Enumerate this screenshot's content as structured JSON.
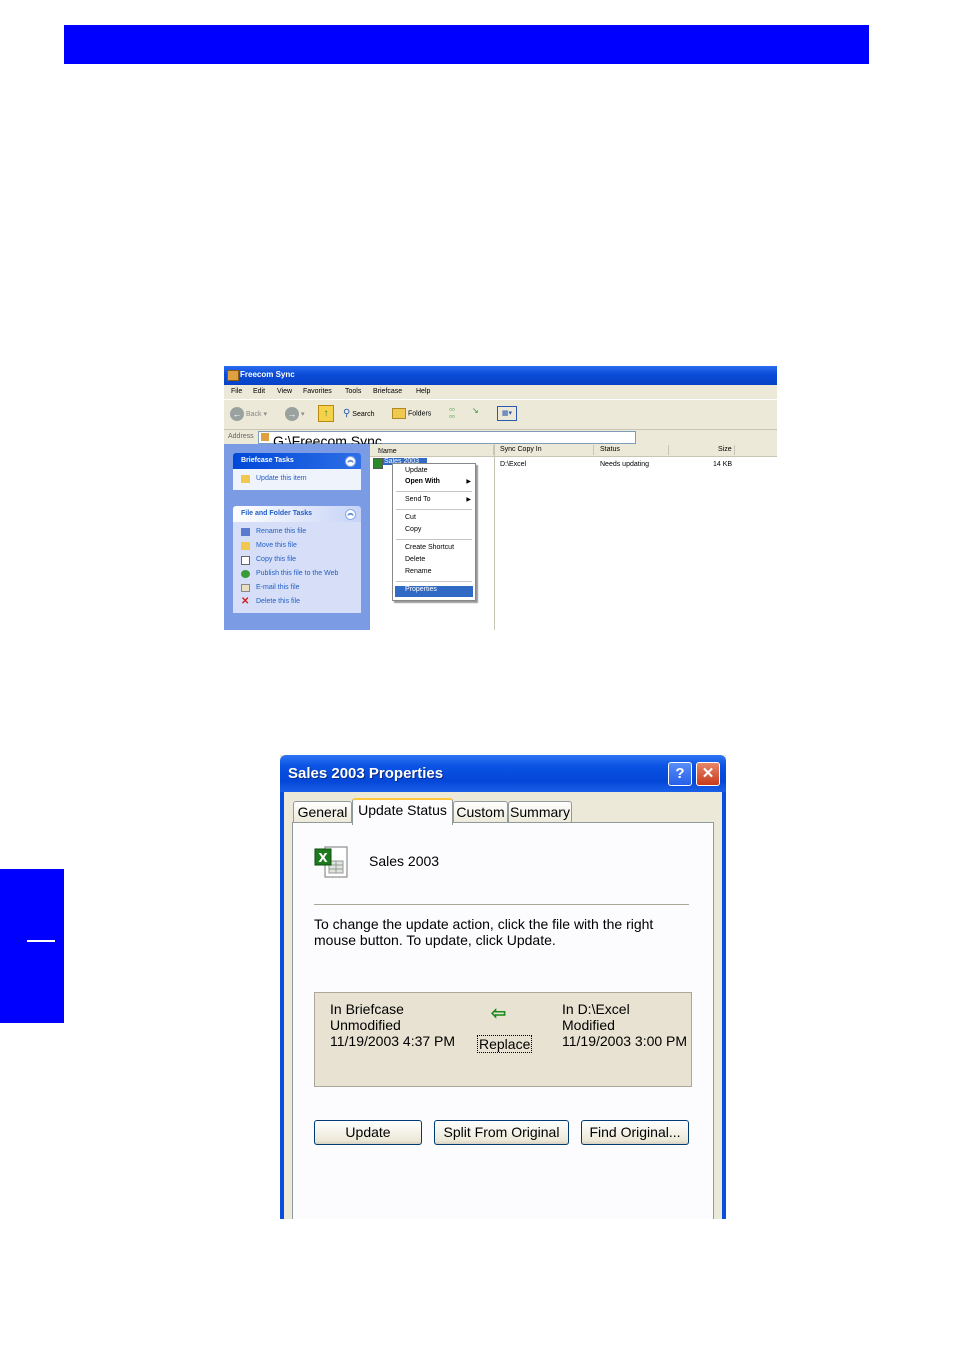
{
  "explorer": {
    "title": "Freecom Sync",
    "menu": [
      "File",
      "Edit",
      "View",
      "Favorites",
      "Tools",
      "Briefcase",
      "Help"
    ],
    "toolbar": {
      "back": "Back",
      "search": "Search",
      "folders": "Folders"
    },
    "address_label": "Address",
    "address_value": "G:\\Freecom Sync",
    "briefcase_tasks": {
      "title": "Briefcase Tasks",
      "items": [
        "Update this item"
      ]
    },
    "file_folder_tasks": {
      "title": "File and Folder Tasks",
      "items": [
        "Rename this file",
        "Move this file",
        "Copy this file",
        "Publish this file to the Web",
        "E-mail this file",
        "Delete this file"
      ]
    },
    "columns": [
      "Name",
      "Sync Copy In",
      "Status",
      "Size"
    ],
    "file_row": {
      "name": "Sales 2003",
      "sync_copy_in": "D:\\Excel",
      "status": "Needs updating",
      "size": "14 KB"
    },
    "context_menu": [
      "Update",
      "Open With",
      "Send To",
      "Cut",
      "Copy",
      "Create Shortcut",
      "Delete",
      "Rename",
      "Properties"
    ]
  },
  "dialog": {
    "title": "Sales 2003 Properties",
    "help_button": "?",
    "close_button": "✕",
    "tabs": [
      "General",
      "Update Status",
      "Custom",
      "Summary"
    ],
    "active_tab": "Update Status",
    "file_name": "Sales 2003",
    "description": "To change the update action, click the file with the right mouse button. To update, click Update.",
    "left_status": {
      "location": "In Briefcase",
      "state": "Unmodified",
      "date": "11/19/2003 4:37 PM"
    },
    "right_status": {
      "location": "In D:\\Excel",
      "state": "Modified",
      "date": "11/19/2003 3:00 PM"
    },
    "action": "Replace",
    "buttons": {
      "update": "Update",
      "split": "Split From Original",
      "find": "Find Original..."
    }
  }
}
